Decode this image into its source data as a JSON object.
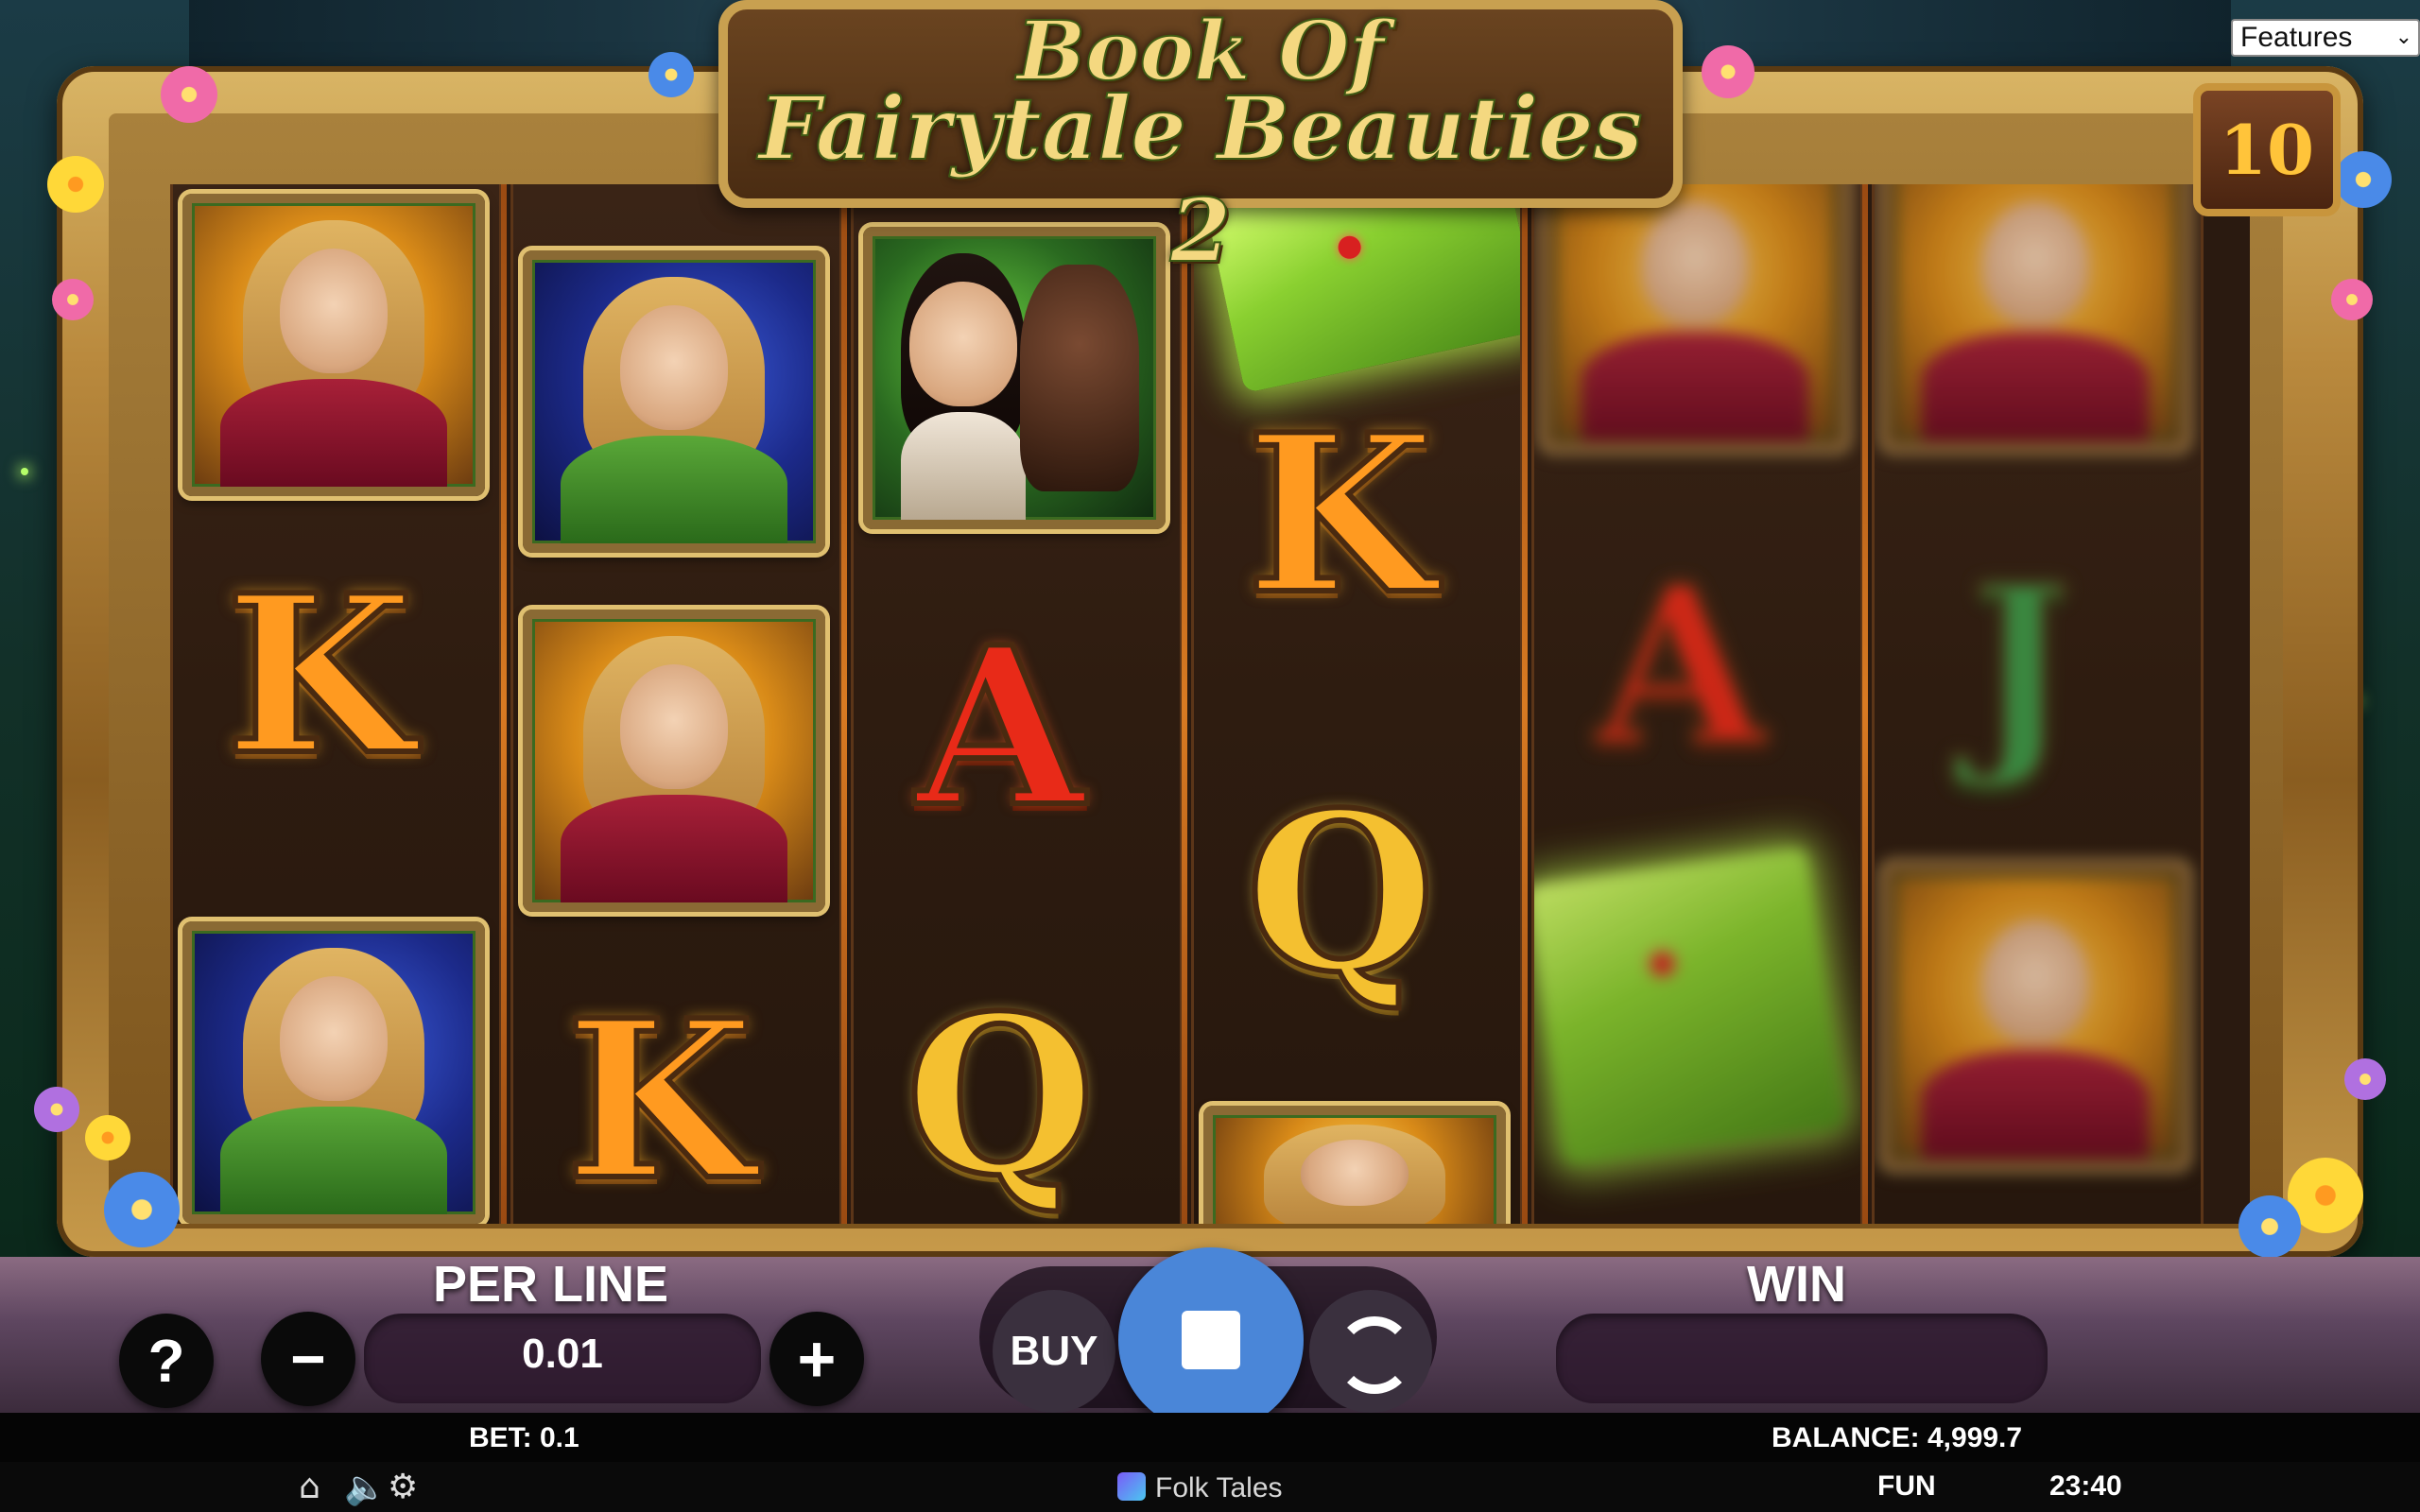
{
  "game": {
    "title_line1": "Book Of",
    "title_line2": "Fairytale Beauties 2",
    "free_spins_badge": "10"
  },
  "features_dropdown": {
    "selected": "Features"
  },
  "controls": {
    "help_label": "?",
    "minus_label": "−",
    "plus_label": "+",
    "per_line_label": "PER LINE",
    "per_line_value": "0.01",
    "buy_label": "BUY",
    "win_label": "WIN",
    "win_value": ""
  },
  "status_bar": {
    "bet": "BET: 0.1",
    "balance": "BALANCE: 4,999.7",
    "game_name": "Folk Tales",
    "mode": "FUN",
    "clock": "23:40"
  },
  "icons": [
    "home-icon",
    "sound-icon",
    "settings-icon",
    "help-icon",
    "minus-icon",
    "plus-icon",
    "stop-icon",
    "autoplay-icon"
  ],
  "reels": [
    [
      "portrait-blonde-red",
      "K",
      "portrait-blonde-green"
    ],
    [
      "portrait-blonde-green",
      "portrait-blonde-red",
      "K"
    ],
    [
      "portrait-snow-beast",
      "A",
      "Q"
    ],
    [
      "book",
      "K",
      "Q",
      "portrait-blonde-red"
    ],
    [
      "portrait-blurred",
      "A",
      "book"
    ],
    [
      "portrait-blurred",
      "J",
      "portrait-blurred"
    ]
  ],
  "colors": {
    "spin_button": "#4a86d8",
    "frame_gold": "#c8953c",
    "letter_k": "#ff9a20",
    "letter_a": "#e82a18",
    "letter_q": "#f4c030",
    "letter_j": "#3c9a48"
  }
}
